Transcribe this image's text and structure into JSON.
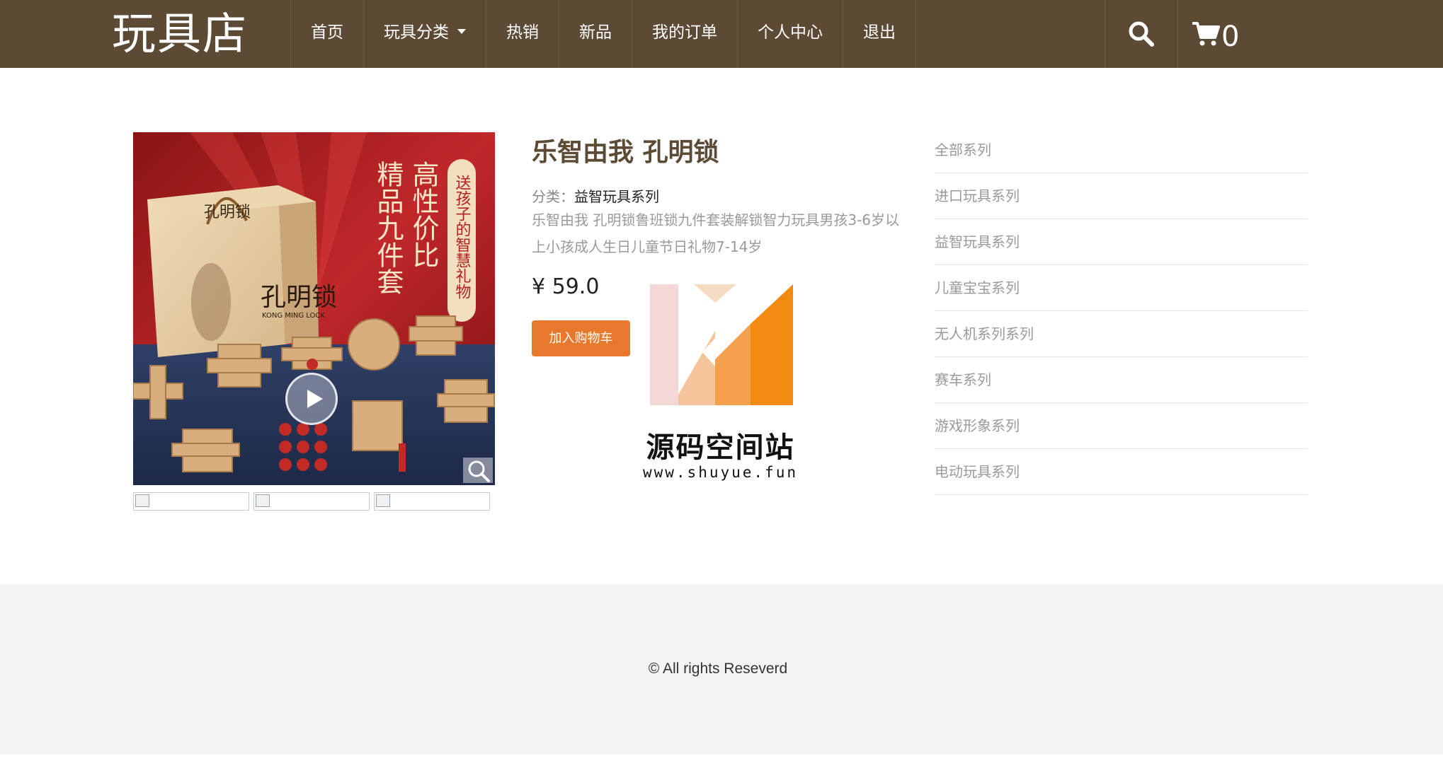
{
  "header": {
    "logo": "玩具店",
    "nav": [
      {
        "label": "首页"
      },
      {
        "label": "玩具分类",
        "dropdown": true
      },
      {
        "label": "热销"
      },
      {
        "label": "新品"
      },
      {
        "label": "我的订单"
      },
      {
        "label": "个人中心"
      },
      {
        "label": "退出"
      }
    ],
    "cart_count": "0",
    "icons": {
      "search": "search-icon",
      "cart": "shopping-cart-icon"
    },
    "bg_color": "#5c4a35"
  },
  "product": {
    "title": "乐智由我 孔明锁",
    "category_label": "分类：",
    "category_value": "益智玩具系列",
    "description": "乐智由我 孔明锁鲁班锁九件套装解锁智力玩具男孩3-6岁以上小孩成人生日儿童节日礼物7-14岁",
    "price": "¥ 59.0",
    "add_to_cart": "加入购物车",
    "image_text": {
      "vertical_1": "精品九件套",
      "vertical_2": "高性价比",
      "vertical_3": "送孩子的智慧礼物",
      "box_title": "孔明锁",
      "box_sub": "KONG MING LOCK"
    },
    "accent_color": "#e8782b"
  },
  "watermark": {
    "name": "源码空间站",
    "url": "www.shuyue.fun"
  },
  "sidebar": {
    "items": [
      {
        "label": "全部系列"
      },
      {
        "label": "进口玩具系列"
      },
      {
        "label": "益智玩具系列"
      },
      {
        "label": "儿童宝宝系列"
      },
      {
        "label": "无人机系列系列"
      },
      {
        "label": "赛车系列"
      },
      {
        "label": "游戏形象系列"
      },
      {
        "label": "电动玩具系列"
      }
    ]
  },
  "footer": {
    "copyright": "© All rights Reseverd"
  }
}
